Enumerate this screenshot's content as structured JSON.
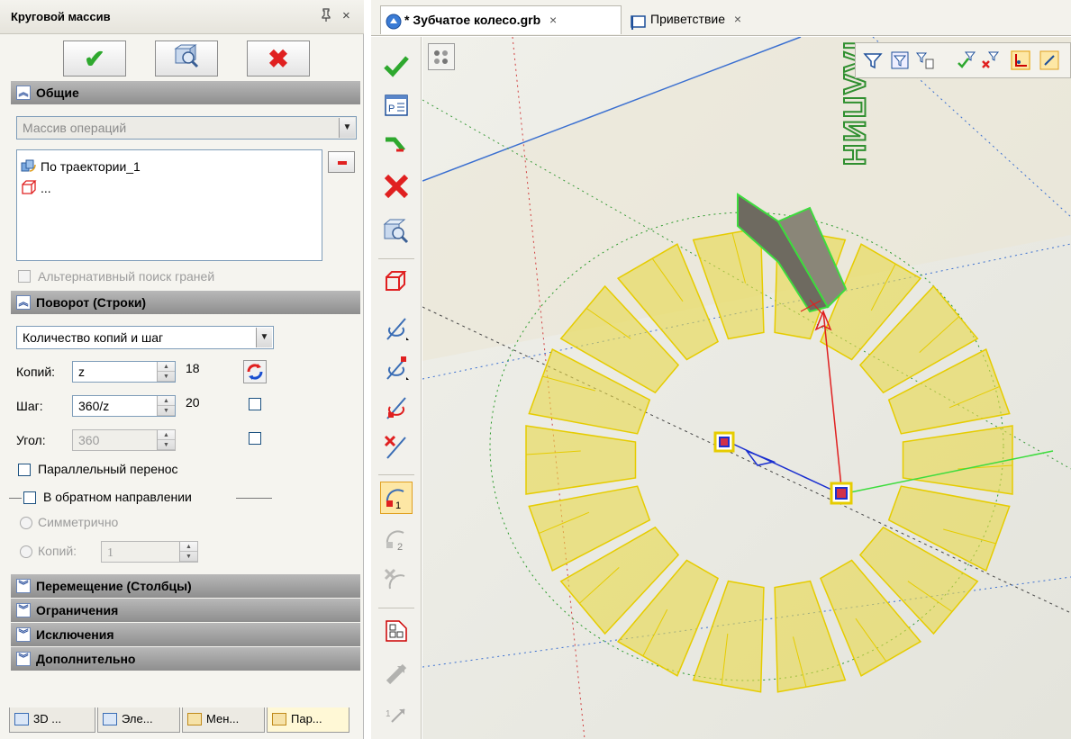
{
  "panel": {
    "title": "Круговой массив",
    "pin_icon": "pin-icon",
    "close_glyph": "×",
    "ok_label": "✔",
    "cancel_label": "✖",
    "sections": {
      "general": "Общие",
      "rotation": "Поворот (Строки)",
      "shift": "Перемещение (Столбцы)",
      "limits": "Ограничения",
      "exclusions": "Исключения",
      "extra": "Дополнительно"
    },
    "operations_combo": "Массив операций",
    "operations_list": [
      {
        "icon": "trajectory-icon",
        "label": "По траектории_1"
      },
      {
        "icon": "cube-outline-icon",
        "label": "..."
      }
    ],
    "alt_face_search": "Альтернативный поиск граней",
    "mode_combo": "Количество копий и шаг",
    "copies_label": "Копий:",
    "copies_value": "z",
    "copies_result": "18",
    "step_label": "Шаг:",
    "step_value": "360/z",
    "step_result": "20",
    "angle_label": "Угол:",
    "angle_value": "360",
    "parallel_shift": "Параллельный перенос",
    "reverse_dir": "В обратном направлении",
    "symmetric": "Симметрично",
    "rev_copies_label": "Копий:",
    "rev_copies_value": "1",
    "bottom_tabs": [
      "3D ...",
      "Эле...",
      "Мен...",
      "Пар..."
    ]
  },
  "document": {
    "tabs": [
      {
        "label": "* Зубчатое колесо.grb",
        "close": "×"
      },
      {
        "label": "Приветствие",
        "close": "×"
      }
    ]
  },
  "colors": {
    "accept_green": "#2ea82e",
    "cancel_red": "#e02020",
    "gear_yellow": "#e8d84a",
    "gear_edge": "#e6cc00",
    "selected_green": "#3ddc3d",
    "axis_red": "#e02020",
    "axis_blue": "#1a2fd0",
    "text_green": "#2f8f2f"
  }
}
